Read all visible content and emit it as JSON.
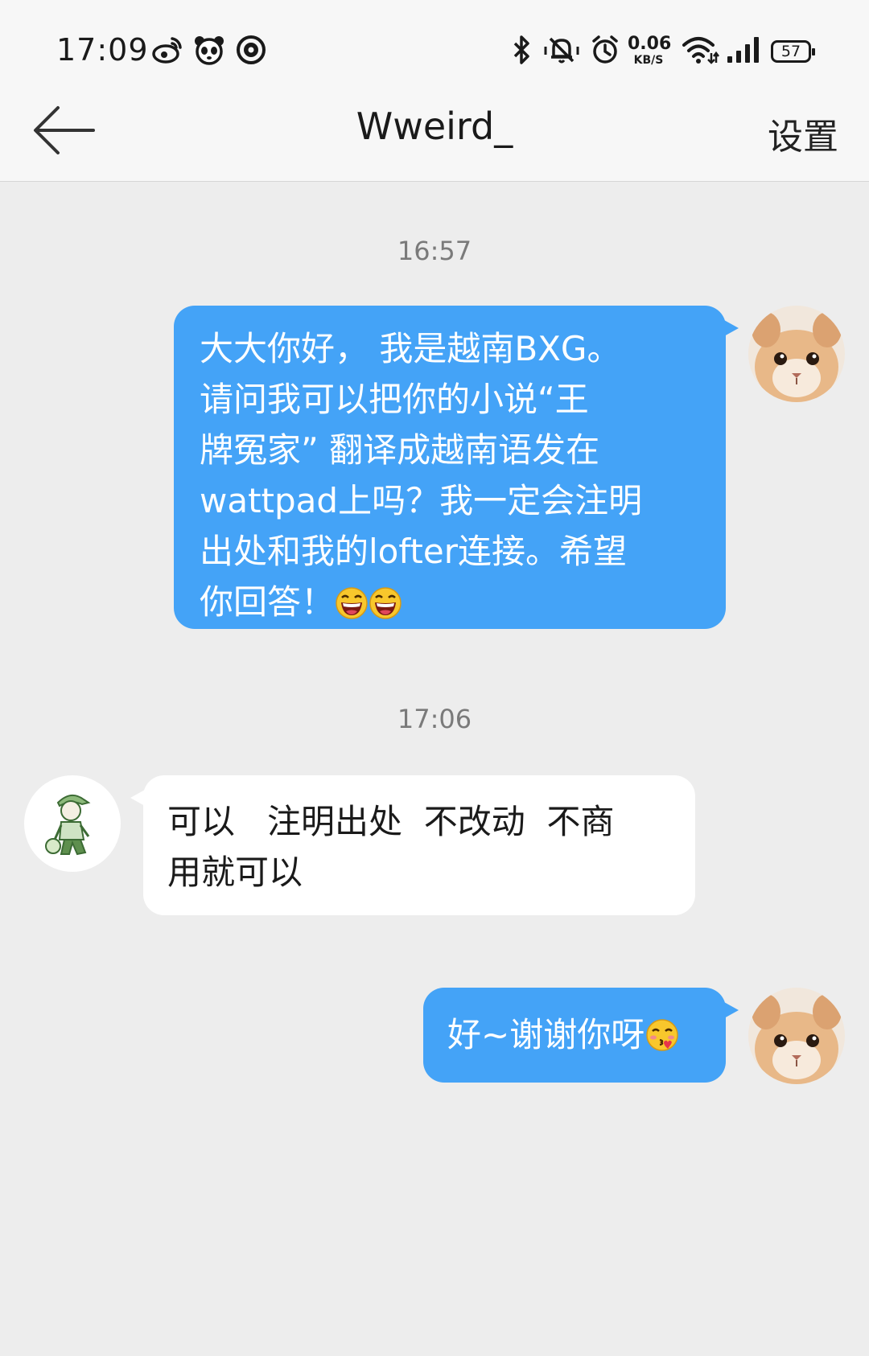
{
  "status_bar": {
    "time": "17:09",
    "net_speed_value": "0.06",
    "net_speed_unit": "KB/S",
    "battery": "57",
    "icons": [
      "weibo-icon",
      "panda-icon",
      "app-icon",
      "bluetooth-icon",
      "vibrate-icon",
      "alarm-icon",
      "wifi-icon",
      "signal-icon"
    ]
  },
  "nav": {
    "title": "Wweird_",
    "settings_label": "设置"
  },
  "messages": [
    {
      "timestamp": "16:57",
      "direction": "out",
      "text": "大大你好， 我是越南BXG。\n请问我可以把你的小说“王\n牌冤家” 翻译成越南语发在\nwattpad上吗？我一定会注明\n出处和我的lofter连接。希望\n你回答！",
      "emojis": [
        "laughing-emoji",
        "laughing-emoji"
      ]
    },
    {
      "timestamp": "17:06",
      "direction": "in",
      "text": "可以   注明出处  不改动  不商\n用就可以"
    },
    {
      "direction": "out",
      "text": "好~谢谢你呀",
      "emojis": [
        "kissing-heart-emoji"
      ]
    }
  ],
  "colors": {
    "outgoing_bubble": "#44a3f7",
    "incoming_bubble": "#ffffff",
    "background": "#ededed"
  }
}
